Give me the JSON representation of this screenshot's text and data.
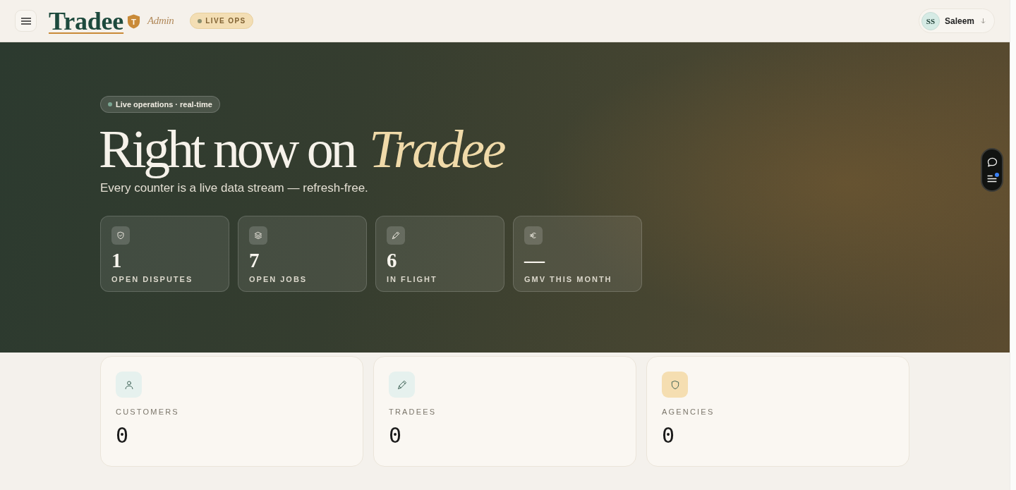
{
  "header": {
    "logo": {
      "wordmark": "Tradee",
      "badge_letter": "T"
    },
    "role": "Admin",
    "status_pill": "LIVE OPS",
    "user": {
      "initials": "SS",
      "name": "Saleem"
    }
  },
  "hero": {
    "badge": "Live operations · real-time",
    "title": "Right now on",
    "title_accent": "Tradee",
    "subtitle": "Every counter is a live data stream — refresh-free.",
    "stats": [
      {
        "kind": "disputes",
        "value": "1",
        "label": "OPEN DISPUTES"
      },
      {
        "kind": "jobs",
        "value": "7",
        "label": "OPEN JOBS"
      },
      {
        "kind": "flight",
        "value": "6",
        "label": "IN FLIGHT"
      },
      {
        "kind": "gmv",
        "value": "—",
        "label": "GMV THIS MONTH"
      }
    ]
  },
  "summary_cards": [
    {
      "kind": "customers",
      "label": "CUSTOMERS",
      "value": "0",
      "color": "#e6f1ee"
    },
    {
      "kind": "tradees",
      "label": "TRADEES",
      "value": "0",
      "color": "#e6f1ee"
    },
    {
      "kind": "agencies",
      "label": "AGENCIES",
      "value": "0",
      "color": "#f5deb1"
    }
  ],
  "floating_toolbar": {
    "notification": true
  }
}
